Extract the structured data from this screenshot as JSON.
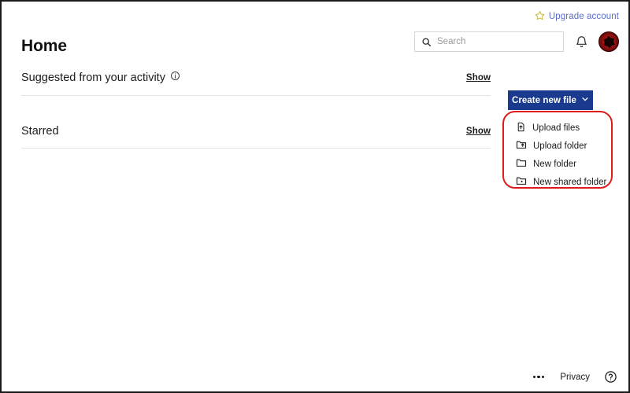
{
  "utility": {
    "upgrade_label": "Upgrade account",
    "star_icon": "star-outline-icon"
  },
  "header": {
    "title": "Home",
    "search": {
      "placeholder": "Search",
      "value": "",
      "icon": "search-icon"
    },
    "notifications_icon": "bell-icon",
    "avatar_icon": "user-avatar"
  },
  "sections": [
    {
      "title": "Suggested from your activity",
      "info_icon": "info-circle-icon",
      "show_label": "Show"
    },
    {
      "title": "Starred",
      "show_label": "Show"
    }
  ],
  "create_menu": {
    "button_label": "Create new file",
    "button_chevron": "chevron-down-icon",
    "button_color": "#1a3a8f",
    "highlight_color": "#e01b1b",
    "items": [
      {
        "label": "Upload files",
        "icon": "file-upload-icon"
      },
      {
        "label": "Upload folder",
        "icon": "folder-upload-icon"
      },
      {
        "label": "New folder",
        "icon": "folder-icon"
      },
      {
        "label": "New shared folder",
        "icon": "folder-shared-icon"
      }
    ]
  },
  "footer": {
    "more_icon": "ellipsis-icon",
    "privacy_label": "Privacy",
    "help_icon": "question-circle-icon"
  }
}
